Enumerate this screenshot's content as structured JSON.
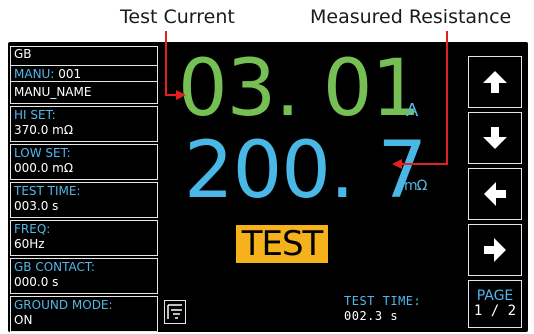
{
  "callouts": {
    "test_current": "Test Current",
    "measured_resistance": "Measured Resistance"
  },
  "left_panel": {
    "mode": "GB",
    "manu_label": "MANU:",
    "manu_number": "001",
    "manu_name": "MANU_NAME",
    "items": [
      {
        "label": "HI SET:",
        "value": "370.0 mΩ"
      },
      {
        "label": "LOW SET:",
        "value": "000.0 mΩ"
      },
      {
        "label": "TEST TIME:",
        "value": "003.0 s"
      },
      {
        "label": "FREQ:",
        "value": "60Hz"
      },
      {
        "label": "GB CONTACT:",
        "value": "000.0 s"
      },
      {
        "label": "GROUND MODE:",
        "value": "ON"
      }
    ]
  },
  "readings": {
    "current": "03. 01",
    "current_unit": "A",
    "resistance": "200. 7",
    "resistance_unit": "mΩ"
  },
  "status": {
    "badge": "TEST",
    "test_time_label": "TEST TIME:",
    "test_time_value": "002.3 s"
  },
  "buttons": {
    "icons": [
      "arrow-up-icon",
      "arrow-down-icon",
      "arrow-left-icon",
      "arrow-right-icon"
    ],
    "page_label": "PAGE",
    "page_value": "1 / 2"
  },
  "colors": {
    "current_green": "#76bf54",
    "resistance_blue": "#49b8e6",
    "label_blue": "#52b6e8",
    "badge_yellow": "#f6b21a",
    "callout_red": "#e0211f"
  }
}
